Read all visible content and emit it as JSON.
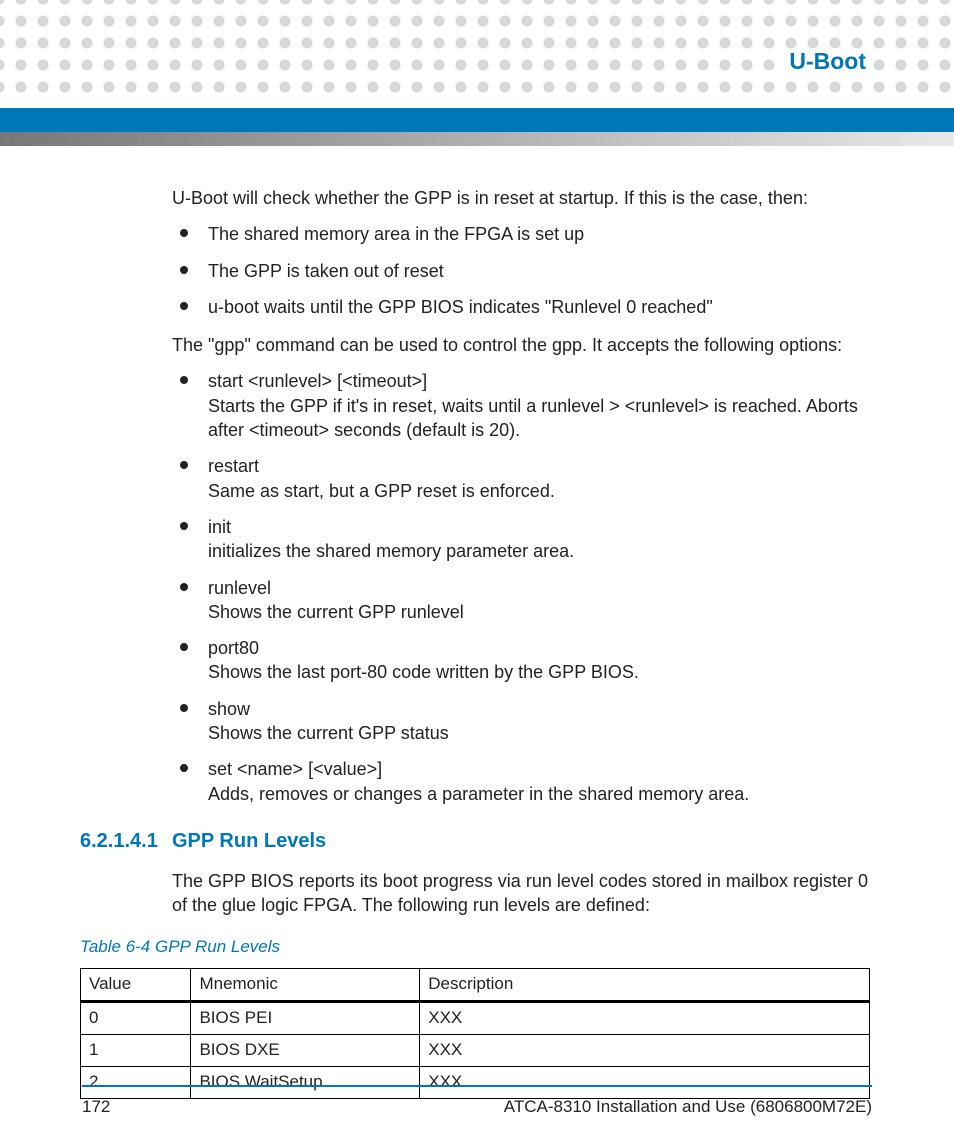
{
  "chapter_title": "U-Boot",
  "intro": "U-Boot will check whether the GPP is in reset at startup. If this is the case, then:",
  "list1": {
    "i0": "The shared memory area in the FPGA is set up",
    "i1": "The GPP is taken out of reset",
    "i2": "u-boot waits until the GPP BIOS indicates \"Runlevel 0 reached\""
  },
  "para2": "The \"gpp\" command can be used to control the gpp. It accepts the following options:",
  "list2": {
    "i0": "start <runlevel> [<timeout>]\nStarts the GPP if it's in reset, waits until a runlevel > <runlevel> is reached. Aborts after <timeout> seconds (default is 20).",
    "i1": "restart\nSame as start, but a GPP reset is enforced.",
    "i2": "init\ninitializes the shared memory parameter area.",
    "i3": "runlevel\nShows the current GPP runlevel",
    "i4": "port80\nShows the last port-80 code written by the GPP BIOS.",
    "i5": "show\nShows the current GPP status",
    "i6": "set <name> [<value>]\nAdds, removes or changes a parameter in the shared memory area."
  },
  "section": {
    "number": "6.2.1.4.1",
    "title": "GPP Run Levels",
    "text": "The GPP BIOS reports its boot progress via run level codes stored in mailbox register 0 of the glue logic FPGA. The following run levels are defined:"
  },
  "table": {
    "caption": "Table 6-4 GPP Run Levels",
    "headers": {
      "h0": "Value",
      "h1": "Mnemonic",
      "h2": "Description"
    },
    "rows": {
      "r0": {
        "c0": "0",
        "c1": "BIOS PEI",
        "c2": "XXX"
      },
      "r1": {
        "c0": "1",
        "c1": "BIOS DXE",
        "c2": "XXX"
      },
      "r2": {
        "c0": "2",
        "c1": "BIOS WaitSetup",
        "c2": "XXX"
      }
    }
  },
  "footer": {
    "page": "172",
    "doc": "ATCA-8310 Installation and Use (6806800M72E)"
  }
}
